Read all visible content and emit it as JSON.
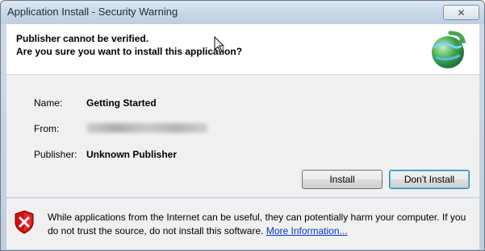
{
  "window": {
    "title": "Application Install - Security Warning",
    "close_glyph": "✕"
  },
  "header": {
    "line1": "Publisher cannot be verified.",
    "line2": "Are you sure you want to install this application?",
    "icon": "globe-install-icon"
  },
  "details": {
    "name_label": "Name:",
    "name_value": "Getting Started",
    "from_label": "From:",
    "publisher_label": "Publisher:",
    "publisher_value": "Unknown Publisher"
  },
  "buttons": {
    "install": "Install",
    "dont_install": "Don't Install"
  },
  "footer": {
    "icon": "security-shield-x-icon",
    "text": "While applications from the Internet can be useful, they can potentially harm your computer. If you do not trust the source, do not install this software.",
    "link": "More Information..."
  },
  "colors": {
    "link": "#0033cc",
    "shield_red": "#d01010"
  }
}
